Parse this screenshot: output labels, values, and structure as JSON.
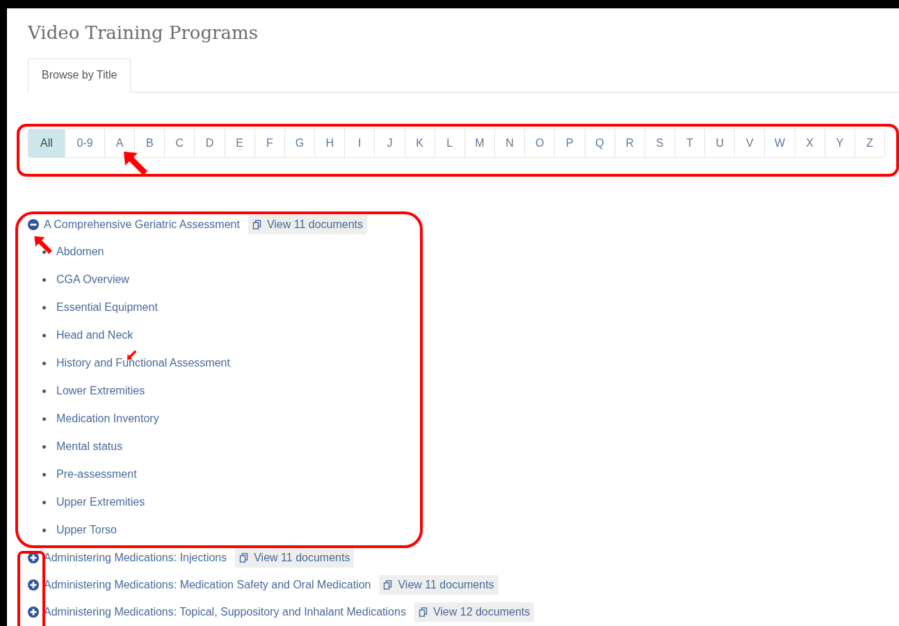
{
  "title": "Video Training Programs",
  "tabs": [
    {
      "label": "Browse by Title",
      "selected": true
    }
  ],
  "letters": [
    {
      "label": "All",
      "selected": true
    },
    {
      "label": "0-9",
      "selected": false
    },
    {
      "label": "A",
      "selected": false
    },
    {
      "label": "B",
      "selected": false
    },
    {
      "label": "C",
      "selected": false
    },
    {
      "label": "D",
      "selected": false
    },
    {
      "label": "E",
      "selected": false
    },
    {
      "label": "F",
      "selected": false
    },
    {
      "label": "G",
      "selected": false
    },
    {
      "label": "H",
      "selected": false
    },
    {
      "label": "I",
      "selected": false
    },
    {
      "label": "J",
      "selected": false
    },
    {
      "label": "K",
      "selected": false
    },
    {
      "label": "L",
      "selected": false
    },
    {
      "label": "M",
      "selected": false
    },
    {
      "label": "N",
      "selected": false
    },
    {
      "label": "O",
      "selected": false
    },
    {
      "label": "P",
      "selected": false
    },
    {
      "label": "Q",
      "selected": false
    },
    {
      "label": "R",
      "selected": false
    },
    {
      "label": "S",
      "selected": false
    },
    {
      "label": "T",
      "selected": false
    },
    {
      "label": "U",
      "selected": false
    },
    {
      "label": "V",
      "selected": false
    },
    {
      "label": "W",
      "selected": false
    },
    {
      "label": "X",
      "selected": false
    },
    {
      "label": "Y",
      "selected": false
    },
    {
      "label": "Z",
      "selected": false
    }
  ],
  "programs": [
    {
      "title": "A Comprehensive Geriatric Assessment",
      "documents": "View 11 documents",
      "expanded": true,
      "children": [
        {
          "title": "Abdomen"
        },
        {
          "title": "CGA Overview"
        },
        {
          "title": "Essential Equipment"
        },
        {
          "title": "Head and Neck"
        },
        {
          "title": "History and Functional Assessment"
        },
        {
          "title": "Lower Extremities"
        },
        {
          "title": "Medication Inventory"
        },
        {
          "title": "Mental status"
        },
        {
          "title": "Pre-assessment"
        },
        {
          "title": "Upper Extremities"
        },
        {
          "title": "Upper Torso"
        }
      ]
    },
    {
      "title": "Administering Medications: Injections",
      "documents": "View 11 documents",
      "expanded": false
    },
    {
      "title": "Administering Medications: Medication Safety and Oral Medication",
      "documents": "View 11 documents",
      "expanded": false
    },
    {
      "title": "Administering Medications: Topical, Suppository and Inhalant Medications",
      "documents": "View 12 documents",
      "expanded": false
    }
  ]
}
